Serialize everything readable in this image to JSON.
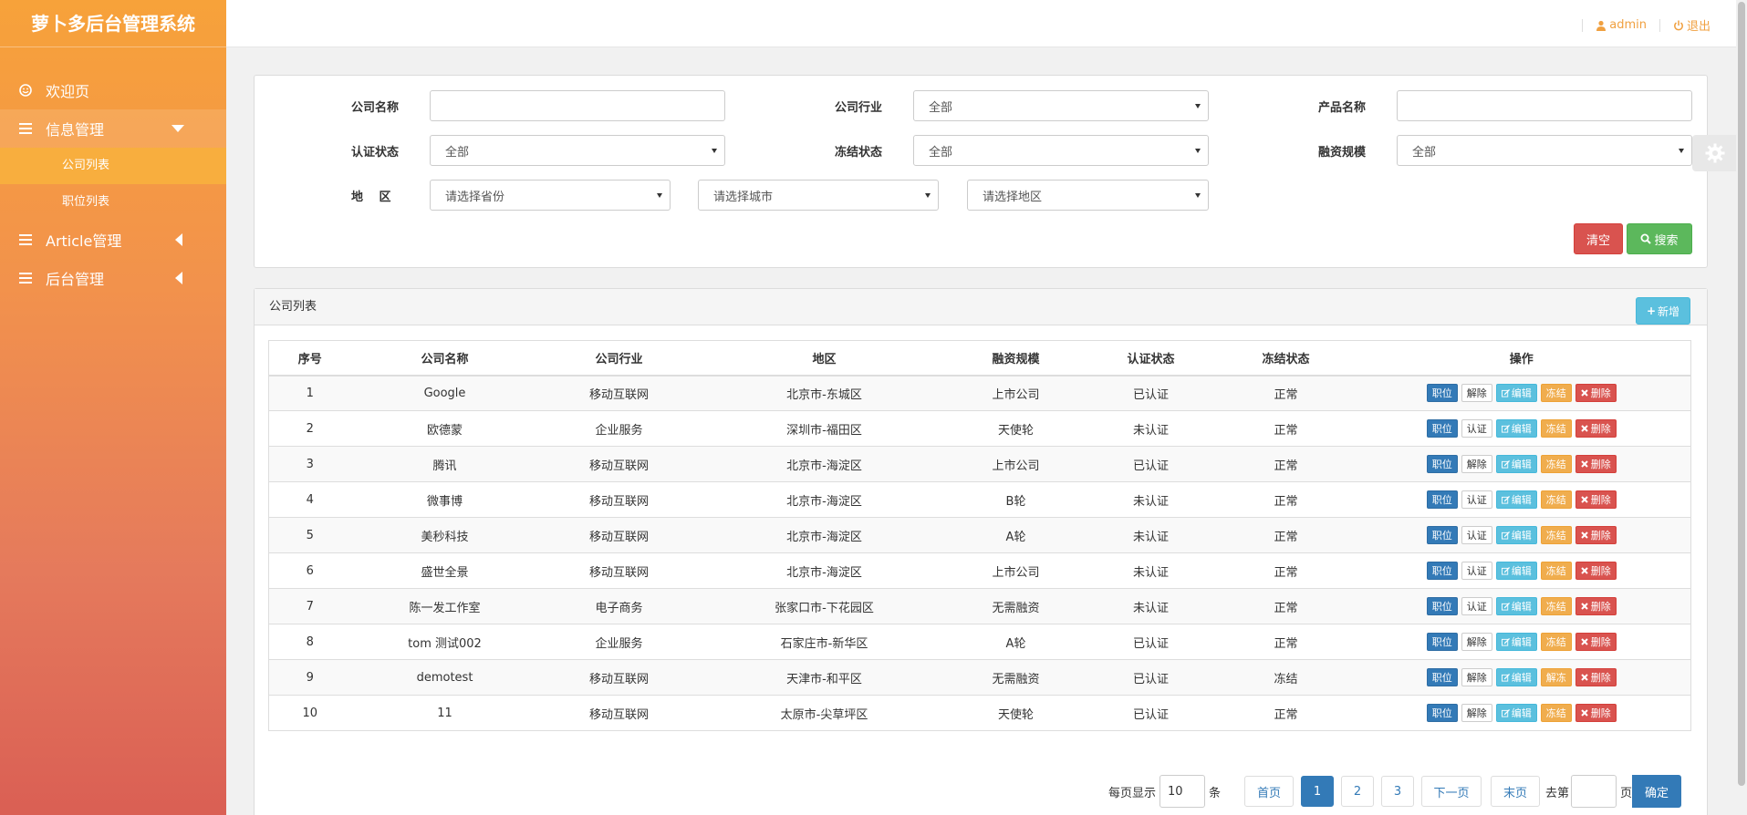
{
  "app": {
    "title": "萝卜多后台管理系统"
  },
  "sidebar": {
    "items": [
      {
        "label": "欢迎页"
      },
      {
        "label": "信息管理",
        "sub": [
          {
            "label": "公司列表"
          },
          {
            "label": "职位列表"
          }
        ]
      },
      {
        "label": "Article管理"
      },
      {
        "label": "后台管理"
      }
    ]
  },
  "topbar": {
    "user": "admin",
    "logout": "退出"
  },
  "search": {
    "company_name_label": "公司名称",
    "company_name_value": "",
    "industry_label": "公司行业",
    "industry_value": "全部",
    "product_label": "产品名称",
    "product_value": "",
    "auth_label": "认证状态",
    "auth_value": "全部",
    "freeze_label": "冻结状态",
    "freeze_value": "全部",
    "funding_label": "融资规模",
    "funding_value": "全部",
    "region_label": "地　 区",
    "province_value": "请选择省份",
    "city_value": "请选择城市",
    "district_value": "请选择地区",
    "clear_label": "清空",
    "search_label": "搜索"
  },
  "list": {
    "title": "公司列表",
    "add_label": "新增",
    "columns": [
      "序号",
      "公司名称",
      "公司行业",
      "地区",
      "融资规模",
      "认证状态",
      "冻结状态",
      "操作"
    ],
    "rows": [
      {
        "no": "1",
        "name": "Google",
        "industry": "移动互联网",
        "region": "北京市-东城区",
        "funding": "上市公司",
        "auth": "已认证",
        "freeze": "正常",
        "op_auth": "解除",
        "op_freeze": "冻结"
      },
      {
        "no": "2",
        "name": "欧德蒙",
        "industry": "企业服务",
        "region": "深圳市-福田区",
        "funding": "天使轮",
        "auth": "未认证",
        "freeze": "正常",
        "op_auth": "认证",
        "op_freeze": "冻结"
      },
      {
        "no": "3",
        "name": "腾讯",
        "industry": "移动互联网",
        "region": "北京市-海淀区",
        "funding": "上市公司",
        "auth": "已认证",
        "freeze": "正常",
        "op_auth": "解除",
        "op_freeze": "冻结"
      },
      {
        "no": "4",
        "name": "微事博",
        "industry": "移动互联网",
        "region": "北京市-海淀区",
        "funding": "B轮",
        "auth": "未认证",
        "freeze": "正常",
        "op_auth": "认证",
        "op_freeze": "冻结"
      },
      {
        "no": "5",
        "name": "美秒科技",
        "industry": "移动互联网",
        "region": "北京市-海淀区",
        "funding": "A轮",
        "auth": "未认证",
        "freeze": "正常",
        "op_auth": "认证",
        "op_freeze": "冻结"
      },
      {
        "no": "6",
        "name": "盛世全景",
        "industry": "移动互联网",
        "region": "北京市-海淀区",
        "funding": "上市公司",
        "auth": "未认证",
        "freeze": "正常",
        "op_auth": "认证",
        "op_freeze": "冻结"
      },
      {
        "no": "7",
        "name": "陈一发工作室",
        "industry": "电子商务",
        "region": "张家口市-下花园区",
        "funding": "无需融资",
        "auth": "未认证",
        "freeze": "正常",
        "op_auth": "认证",
        "op_freeze": "冻结"
      },
      {
        "no": "8",
        "name": "tom 测试002",
        "industry": "企业服务",
        "region": "石家庄市-新华区",
        "funding": "A轮",
        "auth": "已认证",
        "freeze": "正常",
        "op_auth": "解除",
        "op_freeze": "冻结"
      },
      {
        "no": "9",
        "name": "demotest",
        "industry": "移动互联网",
        "region": "天津市-和平区",
        "funding": "无需融资",
        "auth": "已认证",
        "freeze": "冻结",
        "op_auth": "解除",
        "op_freeze": "解冻"
      },
      {
        "no": "10",
        "name": "11",
        "industry": "移动互联网",
        "region": "太原市-尖草坪区",
        "funding": "天使轮",
        "auth": "已认证",
        "freeze": "正常",
        "op_auth": "解除",
        "op_freeze": "冻结"
      }
    ],
    "op_job": "职位",
    "op_edit": "编辑",
    "op_delete": "删除"
  },
  "pager": {
    "per_page_label": "每页显示",
    "per_page_value": "10",
    "per_page_unit": "条",
    "first": "首页",
    "pages": [
      "1",
      "2",
      "3"
    ],
    "current_page": "1",
    "next": "下一页",
    "last": "末页",
    "goto_label": "去第",
    "goto_value": "",
    "page_unit": "页",
    "confirm": "确定"
  }
}
